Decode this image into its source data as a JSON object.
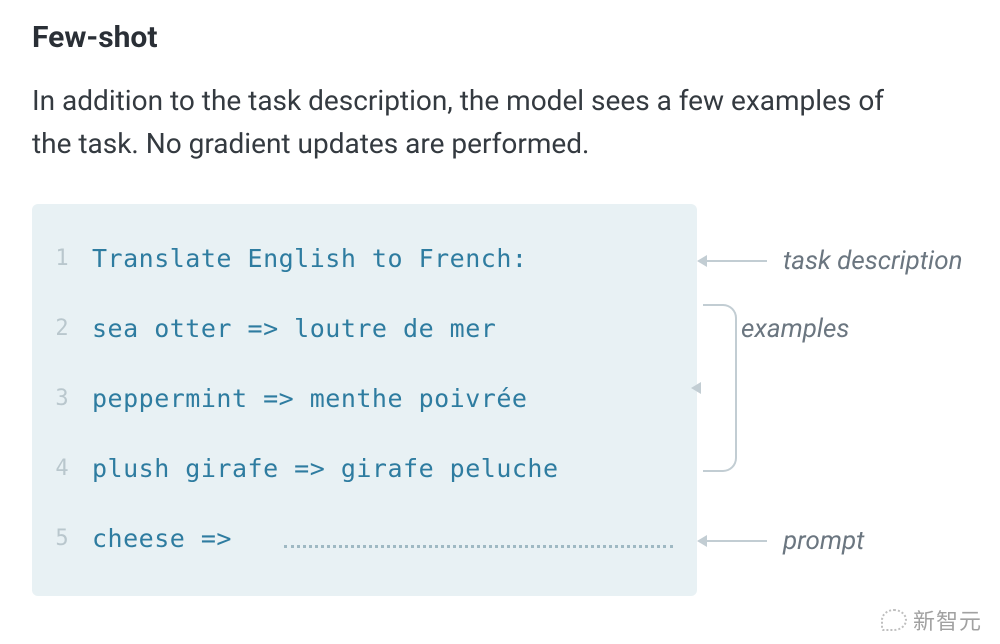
{
  "heading": "Few-shot",
  "description": "In addition to the task description, the model sees a few examples of the task. No gradient updates are performed.",
  "code": {
    "lines": [
      {
        "n": "1",
        "text": "Translate English to French:"
      },
      {
        "n": "2",
        "text": "sea otter => loutre de mer"
      },
      {
        "n": "3",
        "text": "peppermint => menthe poivrée"
      },
      {
        "n": "4",
        "text": "plush girafe => girafe peluche"
      },
      {
        "n": "5",
        "text": "cheese =>"
      }
    ]
  },
  "annotations": {
    "task_description": "task description",
    "examples": "examples",
    "prompt": "prompt"
  },
  "watermark": "新智元"
}
